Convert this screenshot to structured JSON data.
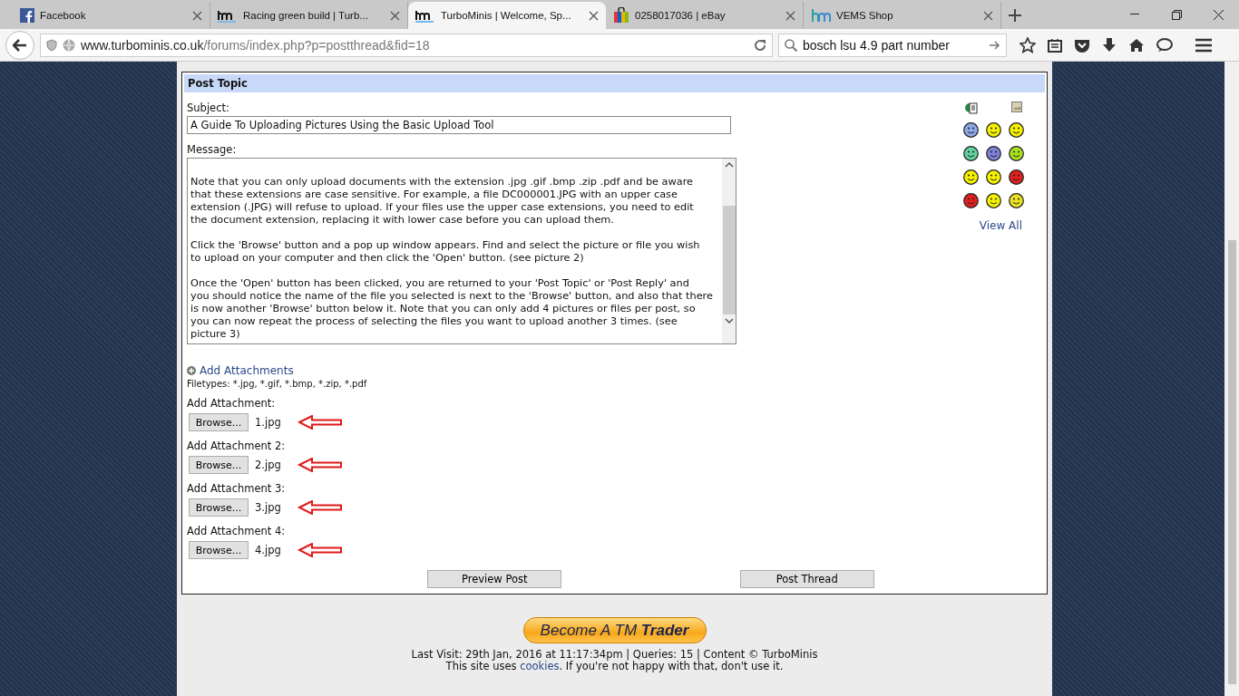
{
  "browser": {
    "tabs": [
      {
        "title": "Facebook",
        "kind": "facebook",
        "selected": false
      },
      {
        "title": "Racing green build | Turb...",
        "kind": "tm",
        "selected": false
      },
      {
        "title": "TurboMinis | Welcome, Sp...",
        "kind": "tm",
        "selected": true
      },
      {
        "title": "0258017036 | eBay",
        "kind": "bag",
        "selected": false
      },
      {
        "title": "VEMS Shop",
        "kind": "vems",
        "selected": false
      }
    ],
    "url_host": "www.turbominis.co.uk",
    "url_path": "/forums/index.php?p=postthread&fid=18",
    "search_value": "bosch lsu 4.9 part number"
  },
  "form": {
    "title": "Post Topic",
    "subject_label": "Subject:",
    "subject_value": "A Guide To Uploading Pictures Using the Basic Upload Tool",
    "message_label": "Message:",
    "message_paragraphs": [
      [
        "Note that you can only upload documents with the extension .jpg .gif .bmp .zip .pdf and be aware",
        "that these extensions are case sensitive. For example, a file DC000001.JPG with an upper case",
        "extension (.JPG) will refuse to upload. If your files use the upper case extensions, you need to edit",
        "the document extension, replacing it with lower case before you can upload them."
      ],
      [
        "Click the 'Browse' button and a pop up window appears. Find and select the picture or file you wish",
        "to upload on your computer and then click the 'Open' button. (see picture 2)"
      ],
      [
        "Once the 'Open' button has been clicked, you are returned to your 'Post Topic' or 'Post Reply' and",
        "you should notice the name of the file you selected is next to the 'Browse' button, and also that there",
        "is now another 'Browse' button below it.  Note that you can only add 4 pictures or files per post, so",
        "you can now repeat the process of selecting the files  you want to upload another 3 times. (see",
        "picture 3)"
      ]
    ],
    "smilies": [
      [
        {
          "kind": "doc"
        },
        {
          "kind": "none"
        },
        {
          "kind": "image"
        }
      ],
      [
        {
          "kind": "face",
          "color": "#8ea8e8"
        },
        {
          "kind": "face",
          "color": "#f5f000"
        },
        {
          "kind": "face",
          "color": "#f5f000"
        }
      ],
      [
        {
          "kind": "face",
          "color": "#60d0a0"
        },
        {
          "kind": "face",
          "color": "#8080d8"
        },
        {
          "kind": "face",
          "color": "#a8e020"
        }
      ],
      [
        {
          "kind": "face",
          "color": "#f5f000"
        },
        {
          "kind": "face",
          "color": "#f5f000"
        },
        {
          "kind": "face",
          "color": "#e02020"
        }
      ],
      [
        {
          "kind": "face",
          "color": "#e02020"
        },
        {
          "kind": "face",
          "color": "#f5f000"
        },
        {
          "kind": "face",
          "color": "#e8e020"
        }
      ]
    ],
    "view_all": "View All",
    "add_attachments": "Add Attachments",
    "filetypes": "Filetypes: *.jpg, *.gif, *.bmp, *.zip, *.pdf",
    "attachments": [
      {
        "label": "Add Attachment:",
        "button": "Browse...",
        "file": "1.jpg"
      },
      {
        "label": "Add Attachment 2:",
        "button": "Browse...",
        "file": "2.jpg"
      },
      {
        "label": "Add Attachment 3:",
        "button": "Browse...",
        "file": "3.jpg"
      },
      {
        "label": "Add Attachment 4:",
        "button": "Browse...",
        "file": "4.jpg"
      }
    ],
    "buttons": [
      "Preview Post",
      "Post Thread"
    ]
  },
  "footer": {
    "trader_button": "Become A TM **Trader**",
    "last_visit": "Last Visit: 29th Jan, 2016 at 11:17:34pm | Queries: 15 | Content © TurboMinis",
    "cookies_before": "This site uses",
    "cookies_link": "cookies",
    "cookies_after": ". If you're not happy with that, don't use it."
  }
}
